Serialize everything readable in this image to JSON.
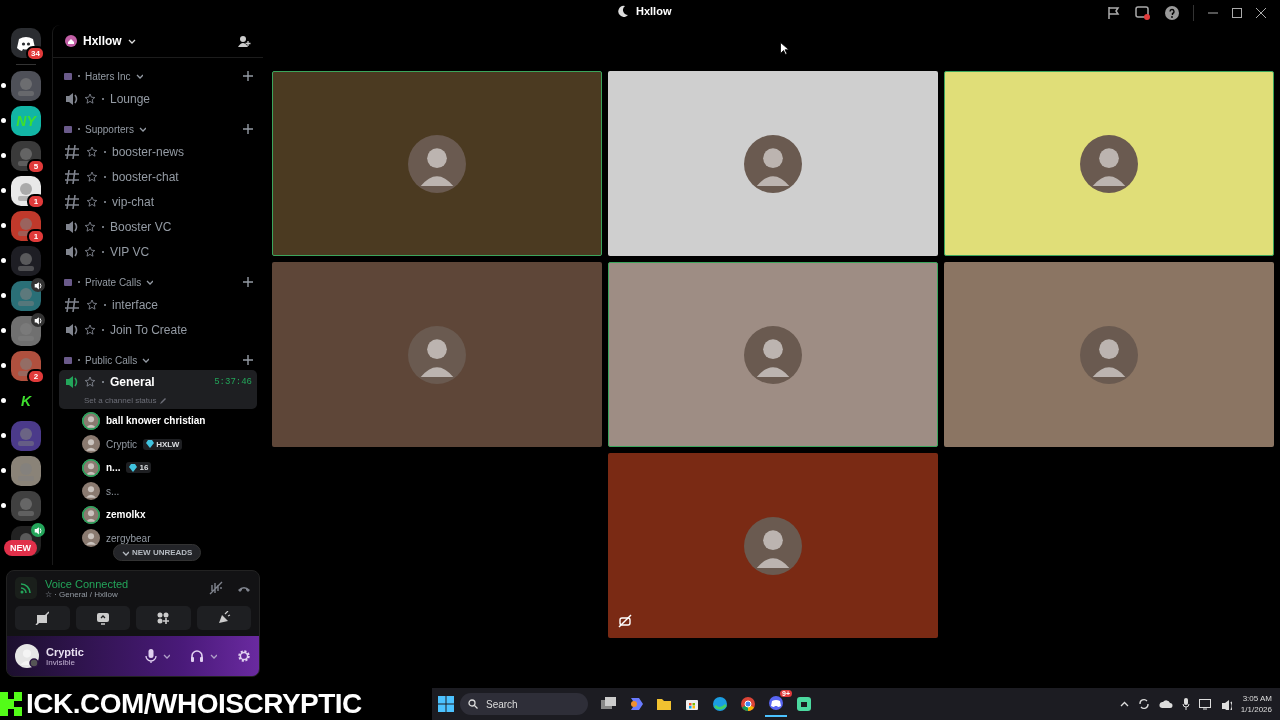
{
  "window": {
    "title": "Hxllow"
  },
  "servers": [
    {
      "kind": "home",
      "color": "#2b2d31",
      "badge": "34",
      "unread": false,
      "in_voice": false
    },
    {
      "kind": "plain",
      "color": "#4e5058",
      "unread": true,
      "in_voice": false
    },
    {
      "kind": "text",
      "label": "NY",
      "color": "#12b5a5",
      "unread": true,
      "in_voice": false
    },
    {
      "kind": "plain",
      "color": "#3a3a3a",
      "badge": "5",
      "unread": true,
      "in_voice": false
    },
    {
      "kind": "plain",
      "color": "#e8e8e8",
      "badge": "1",
      "unread": true,
      "in_voice": false
    },
    {
      "kind": "plain",
      "color": "#c0392b",
      "badge": "1",
      "unread": true,
      "in_voice": false
    },
    {
      "kind": "plain",
      "color": "#1e1e24",
      "unread": true,
      "in_voice": false
    },
    {
      "kind": "plain",
      "color": "#2a6f77",
      "unread": true,
      "in_voice": true
    },
    {
      "kind": "plain",
      "color": "#707070",
      "unread": true,
      "in_voice": true
    },
    {
      "kind": "plain",
      "color": "#b0503e",
      "badge": "2",
      "unread": true,
      "in_voice": false
    },
    {
      "kind": "text",
      "label": "K",
      "color": "#000000",
      "unread": true,
      "in_voice": false
    },
    {
      "kind": "plain",
      "color": "#4b3a8a",
      "unread": true,
      "in_voice": false
    },
    {
      "kind": "plain",
      "color": "#8a8378",
      "unread": true,
      "in_voice": false
    },
    {
      "kind": "plain",
      "color": "#404040",
      "unread": true,
      "in_voice": false
    },
    {
      "kind": "plain",
      "color": "#222222",
      "unread": false,
      "in_voice": true
    }
  ],
  "new_pill": "NEW",
  "sidebar": {
    "server_name": "Hxllow",
    "categories": [
      {
        "name": "Haters Inc",
        "channels": [
          {
            "kind": "voice",
            "name": "Lounge",
            "selected": false
          }
        ]
      },
      {
        "name": "Supporters",
        "channels": [
          {
            "kind": "text",
            "name": "booster-news",
            "selected": false
          },
          {
            "kind": "text",
            "name": "booster-chat",
            "selected": false
          },
          {
            "kind": "text",
            "name": "vip-chat",
            "selected": false
          },
          {
            "kind": "voice",
            "name": "Booster VC",
            "selected": false
          },
          {
            "kind": "voice",
            "name": "VIP VC",
            "selected": false
          }
        ]
      },
      {
        "name": "Private Calls",
        "channels": [
          {
            "kind": "text",
            "name": "interface",
            "selected": false
          },
          {
            "kind": "voice",
            "name": "Join To Create",
            "selected": false
          }
        ]
      },
      {
        "name": "Public Calls",
        "channels": [
          {
            "kind": "voice",
            "name": "General",
            "selected": true,
            "timer": "5:37:46",
            "status": "Set a channel status",
            "members": [
              {
                "name": "ball knower christian",
                "bold": true,
                "speaking": true
              },
              {
                "name": "Cryptic",
                "bold": false,
                "speaking": false,
                "tag": "HXLW"
              },
              {
                "name": "n...",
                "bold": true,
                "speaking": true,
                "tag": "16"
              },
              {
                "name": "s...",
                "bold": false,
                "speaking": false
              },
              {
                "name": "zemolkx",
                "bold": true,
                "speaking": true
              },
              {
                "name": "zergybear",
                "bold": false,
                "speaking": false
              }
            ]
          }
        ]
      }
    ],
    "new_unreads": "NEW UNREADS"
  },
  "voice_panel": {
    "status": "Voice Connected",
    "location": "☆ · General / Hxllow"
  },
  "user": {
    "name": "Cryptic",
    "status": "Invisible"
  },
  "tiles": [
    {
      "color": "#4b3a21",
      "speaking": true,
      "video_off": false
    },
    {
      "color": "#cfcfcf",
      "speaking": false,
      "video_off": false
    },
    {
      "color": "#e0de78",
      "speaking": true,
      "video_off": false
    },
    {
      "color": "#5e4638",
      "speaking": false,
      "video_off": false
    },
    {
      "color": "#9e8d84",
      "speaking": true,
      "video_off": false
    },
    {
      "color": "#8b7563",
      "speaking": false,
      "video_off": false
    },
    {
      "color": "#7a2a14",
      "speaking": false,
      "video_off": true
    }
  ],
  "overlay": {
    "text": "ICK.COM/WHOISCRYPTIC"
  },
  "taskbar": {
    "search": "Search",
    "apps": [
      {
        "kind": "taskview",
        "active": false
      },
      {
        "kind": "copilot",
        "active": false
      },
      {
        "kind": "folder",
        "active": false
      },
      {
        "kind": "store",
        "active": false
      },
      {
        "kind": "edge",
        "active": false
      },
      {
        "kind": "chrome",
        "active": false
      },
      {
        "kind": "discord",
        "active": true,
        "badge": "9+"
      },
      {
        "kind": "green-app",
        "active": false
      }
    ],
    "time": "3:05 AM",
    "date": "1/1/2026"
  }
}
